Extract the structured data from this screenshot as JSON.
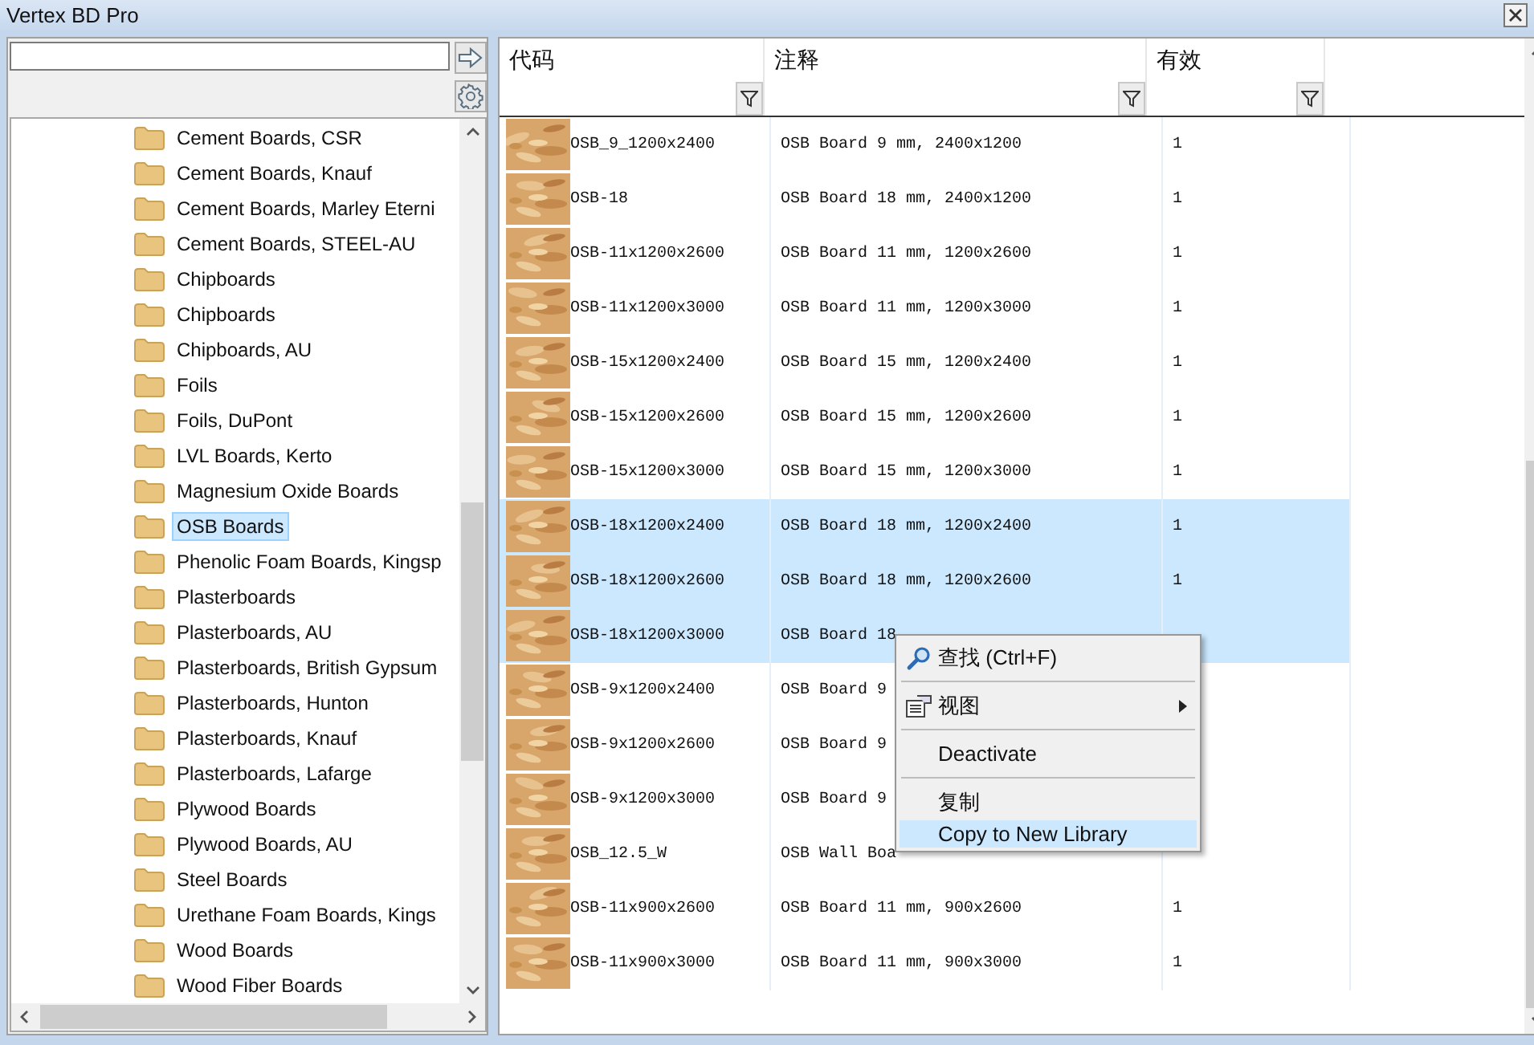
{
  "window": {
    "title": "Vertex BD Pro"
  },
  "tree": {
    "items": [
      {
        "label": "Cement Boards, CSR",
        "selected": false
      },
      {
        "label": "Cement Boards, Knauf",
        "selected": false
      },
      {
        "label": "Cement Boards, Marley Eterni",
        "selected": false
      },
      {
        "label": "Cement Boards, STEEL-AU",
        "selected": false
      },
      {
        "label": "Chipboards",
        "selected": false
      },
      {
        "label": "Chipboards",
        "selected": false
      },
      {
        "label": "Chipboards, AU",
        "selected": false
      },
      {
        "label": "Foils",
        "selected": false
      },
      {
        "label": "Foils, DuPont",
        "selected": false
      },
      {
        "label": "LVL Boards, Kerto",
        "selected": false
      },
      {
        "label": "Magnesium Oxide Boards",
        "selected": false
      },
      {
        "label": "OSB Boards",
        "selected": true
      },
      {
        "label": "Phenolic Foam Boards, Kingsp",
        "selected": false
      },
      {
        "label": "Plasterboards",
        "selected": false
      },
      {
        "label": "Plasterboards, AU",
        "selected": false
      },
      {
        "label": "Plasterboards, British Gypsum",
        "selected": false
      },
      {
        "label": "Plasterboards, Hunton",
        "selected": false
      },
      {
        "label": "Plasterboards, Knauf",
        "selected": false
      },
      {
        "label": "Plasterboards, Lafarge",
        "selected": false
      },
      {
        "label": "Plywood Boards",
        "selected": false
      },
      {
        "label": "Plywood Boards, AU",
        "selected": false
      },
      {
        "label": "Steel Boards",
        "selected": false
      },
      {
        "label": "Urethane Foam Boards, Kings",
        "selected": false
      },
      {
        "label": "Wood Boards",
        "selected": false
      },
      {
        "label": "Wood Fiber Boards",
        "selected": false
      }
    ]
  },
  "table": {
    "columns": [
      "代码",
      "注释",
      "有效"
    ],
    "rows": [
      {
        "code": "OSB_9_1200x2400",
        "note": "OSB Board 9 mm, 2400x1200",
        "valid": "1",
        "selected": false
      },
      {
        "code": "OSB-18",
        "note": "OSB Board 18 mm, 2400x1200",
        "valid": "1",
        "selected": false
      },
      {
        "code": "OSB-11x1200x2600",
        "note": "OSB Board 11 mm, 1200x2600",
        "valid": "1",
        "selected": false
      },
      {
        "code": "OSB-11x1200x3000",
        "note": "OSB Board 11 mm, 1200x3000",
        "valid": "1",
        "selected": false
      },
      {
        "code": "OSB-15x1200x2400",
        "note": "OSB Board 15 mm, 1200x2400",
        "valid": "1",
        "selected": false
      },
      {
        "code": "OSB-15x1200x2600",
        "note": "OSB Board 15 mm, 1200x2600",
        "valid": "1",
        "selected": false
      },
      {
        "code": "OSB-15x1200x3000",
        "note": "OSB Board 15 mm, 1200x3000",
        "valid": "1",
        "selected": false
      },
      {
        "code": "OSB-18x1200x2400",
        "note": "OSB Board 18 mm, 1200x2400",
        "valid": "1",
        "selected": true
      },
      {
        "code": "OSB-18x1200x2600",
        "note": "OSB Board 18 mm, 1200x2600",
        "valid": "1",
        "selected": true
      },
      {
        "code": "OSB-18x1200x3000",
        "note": "OSB Board 18",
        "selected": true
      },
      {
        "code": "OSB-9x1200x2400",
        "note": "OSB Board 9",
        "selected": false
      },
      {
        "code": "OSB-9x1200x2600",
        "note": "OSB Board 9",
        "selected": false
      },
      {
        "code": "OSB-9x1200x3000",
        "note": "OSB Board 9",
        "selected": false
      },
      {
        "code": "OSB_12.5_W",
        "note": "OSB Wall Boa",
        "selected": false
      },
      {
        "code": "OSB-11x900x2600",
        "note": "OSB Board 11 mm, 900x2600",
        "valid": "1",
        "selected": false
      },
      {
        "code": "OSB-11x900x3000",
        "note": "OSB Board 11 mm, 900x3000",
        "valid": "1",
        "selected": false
      }
    ]
  },
  "context_menu": {
    "items": [
      {
        "kind": "find",
        "label": "查找 (Ctrl+F)",
        "selected": false
      },
      {
        "kind": "separator"
      },
      {
        "kind": "submenu",
        "label": "视图",
        "selected": false
      },
      {
        "kind": "separator"
      },
      {
        "kind": "plain",
        "label": "Deactivate",
        "selected": false
      },
      {
        "kind": "separator"
      },
      {
        "kind": "plain",
        "label": "复制",
        "selected": false
      },
      {
        "kind": "plain",
        "label": "Copy to New Library",
        "selected": true
      }
    ]
  }
}
